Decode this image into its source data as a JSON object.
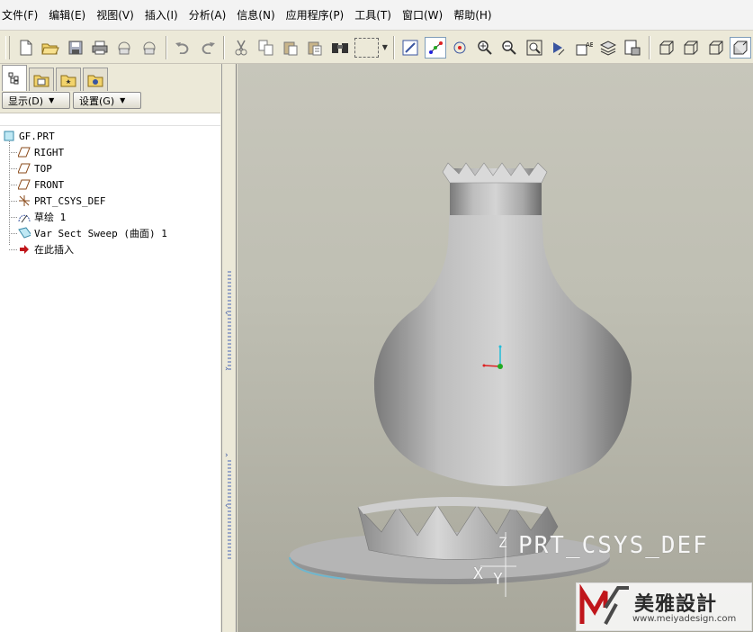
{
  "menu": [
    "文件(F)",
    "编辑(E)",
    "视图(V)",
    "插入(I)",
    "分析(A)",
    "信息(N)",
    "应用程序(P)",
    "工具(T)",
    "窗口(W)",
    "帮助(H)"
  ],
  "toolbar": {
    "icons": [
      "new-icon",
      "open-icon",
      "save-icon",
      "print-icon",
      "send-email-icon",
      "send-link-icon",
      "undo-icon",
      "redo-icon",
      "cut-icon",
      "copy-icon",
      "paste-icon",
      "paste-special-icon",
      "search-icon",
      "select-box-icon",
      "repaint-icon",
      "spin-center-icon",
      "orient-mode-icon",
      "zoom-in-icon",
      "zoom-out-icon",
      "refit-icon",
      "reorient-icon",
      "saved-views-icon",
      "layers-icon",
      "view-manager-icon",
      "wireframe-icon",
      "hidden-line-icon",
      "no-hidden-icon",
      "shading-icon"
    ]
  },
  "panel": {
    "show_button": "显示(D)",
    "settings_button": "设置(G)"
  },
  "tree": {
    "items": [
      {
        "label": "GF.PRT",
        "icon": "part-icon"
      },
      {
        "label": "RIGHT",
        "icon": "datum-plane-icon"
      },
      {
        "label": "TOP",
        "icon": "datum-plane-icon"
      },
      {
        "label": "FRONT",
        "icon": "datum-plane-icon"
      },
      {
        "label": "PRT_CSYS_DEF",
        "icon": "coordinate-system-icon"
      },
      {
        "label": "草绘 1",
        "icon": "sketch-icon"
      },
      {
        "label": "Var Sect Sweep (曲面) 1",
        "icon": "sweep-surface-icon"
      },
      {
        "label": "在此插入",
        "icon": "insert-here-arrow-icon"
      }
    ]
  },
  "viewport": {
    "csys_label": "PRT_CSYS_DEF",
    "axis_z": "Z",
    "axis_x": "X",
    "axis_y": "Y"
  },
  "watermark": {
    "name": "美雅設計",
    "url": "www.meiyadesign.com"
  },
  "colors": {
    "accent_blue": "#3a55a0",
    "viewport_bg": "#bfbfb3",
    "model_gray": "#b4b4b4"
  }
}
